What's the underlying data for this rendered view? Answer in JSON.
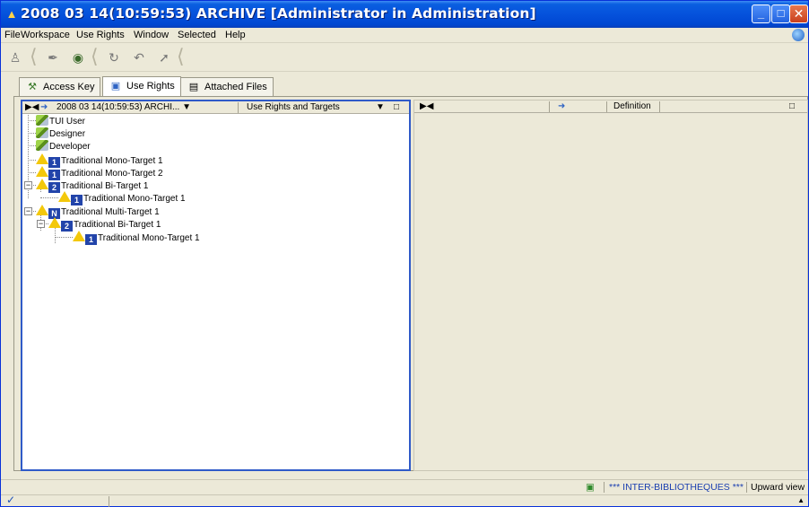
{
  "window": {
    "title": "2008 03 14(10:59:53) ARCHIVE [Administrator in Administration]",
    "title_icon": "app-icon",
    "controls": [
      "minimize-icon",
      "maximize-icon",
      "close-icon"
    ]
  },
  "menubar": {
    "items": [
      "File",
      "Workspace",
      "Use Rights",
      "Window",
      "Selected",
      "Help"
    ]
  },
  "toolbar": {
    "tools": [
      "users-icon",
      "pen-icon",
      "globe-icon",
      "refresh-icon",
      "undo-icon",
      "forward-icon"
    ]
  },
  "tabs": [
    {
      "label": "Access Key",
      "icon": "key-icon",
      "active": false
    },
    {
      "label": "Use Rights",
      "icon": "monitor-icon",
      "active": true
    },
    {
      "label": "Attached Files",
      "icon": "document-icon",
      "active": false
    }
  ],
  "left_panel": {
    "nav_icons": [
      "collapse-icon",
      "arrow-right-icon"
    ],
    "archive_select": "2008 03 14(10:59:53) ARCHI...",
    "view_select": "Use Rights and Targets",
    "tree": [
      {
        "label": "TUI User",
        "type": "user"
      },
      {
        "label": "Designer",
        "type": "user"
      },
      {
        "label": "Developer",
        "type": "user"
      },
      {
        "label": "Traditional Mono-Target 1",
        "type": "mono"
      },
      {
        "label": "Traditional Mono-Target 2",
        "type": "mono"
      },
      {
        "label": "Traditional Bi-Target 1",
        "type": "bi"
      },
      {
        "label": "Traditional Mono-Target 1",
        "type": "mono"
      },
      {
        "label": "Traditional Multi-Target 1",
        "type": "multi"
      },
      {
        "label": "Traditional Bi-Target 1",
        "type": "bi"
      },
      {
        "label": "Traditional Mono-Target 1",
        "type": "mono"
      }
    ]
  },
  "right_panel": {
    "column_definition": "Definition"
  },
  "statusbar": {
    "library": "*** INTER-BIBLIOTHEQUES ***",
    "view": "Upward view"
  },
  "colors": {
    "titlebar": "#0551dc",
    "panel_border": "#2f5ac8",
    "warning": "#f3c80b",
    "chrome": "#ece9d8"
  }
}
